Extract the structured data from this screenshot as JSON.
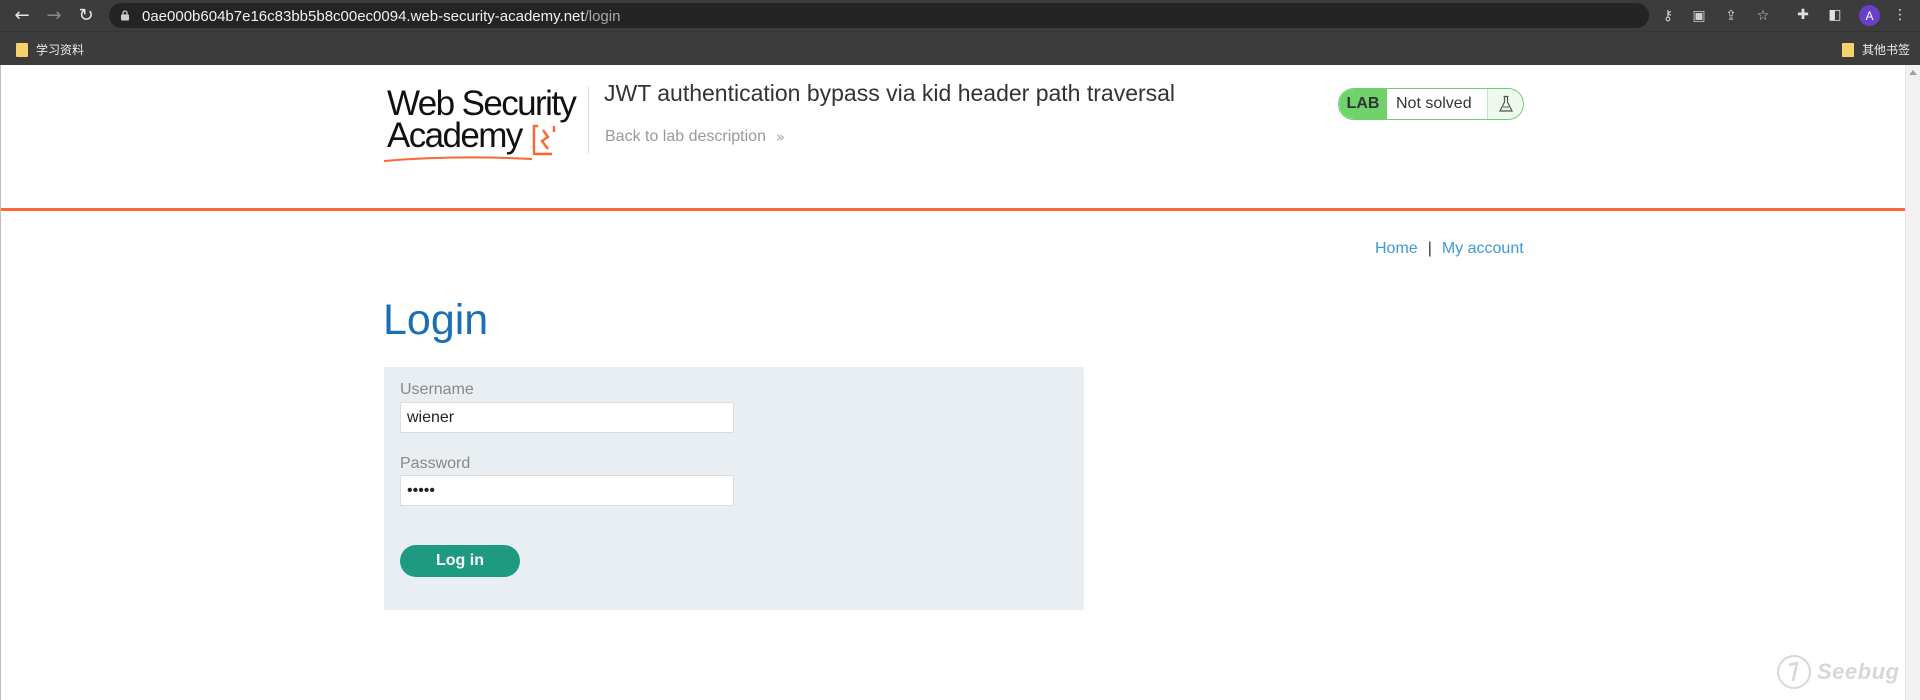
{
  "browser": {
    "url_host": "0ae000b604b7e16c83bb5b8c00ec0094.web-security-academy.net",
    "url_path": "/login",
    "avatar_letter": "A",
    "bookmarks": [
      {
        "label": "学习资料"
      },
      {
        "label": "其他书签"
      }
    ]
  },
  "header": {
    "logo_line1": "Web Security",
    "logo_line2": "Academy",
    "lab_title": "JWT authentication bypass via kid header path traversal",
    "back_link": "Back to lab description",
    "badge": {
      "lab": "LAB",
      "status": "Not solved"
    }
  },
  "nav": {
    "home": "Home",
    "separator": "|",
    "my_account": "My account"
  },
  "login": {
    "heading": "Login",
    "username_label": "Username",
    "username_value": "wiener",
    "password_label": "Password",
    "password_value": "•••••",
    "submit_label": "Log in"
  },
  "watermark": "Seebug",
  "colors": {
    "accent_orange": "#ff6633",
    "heading_blue": "#1a6fb5",
    "link_blue": "#3c9ad8",
    "button_green": "#1e9a80",
    "lab_green": "#70d26b"
  }
}
